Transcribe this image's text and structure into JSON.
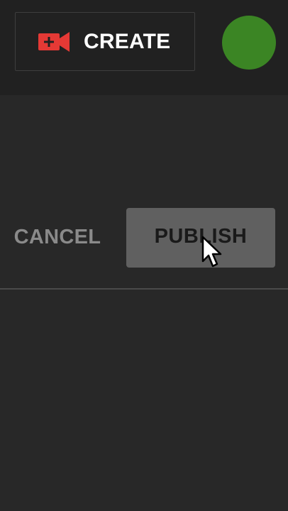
{
  "header": {
    "create_button": {
      "label": "CREATE",
      "icon": "video-camera-plus-icon",
      "icon_color": "#e53935"
    },
    "avatar": {
      "color": "#3b8524"
    }
  },
  "actions": {
    "cancel_label": "CANCEL",
    "publish_label": "PUBLISH"
  },
  "cursor": {
    "icon": "mouse-pointer-icon"
  },
  "colors": {
    "background": "#282828",
    "topbar": "#212121",
    "publish_bg": "#606060",
    "cancel_text": "#8a8a8a"
  }
}
